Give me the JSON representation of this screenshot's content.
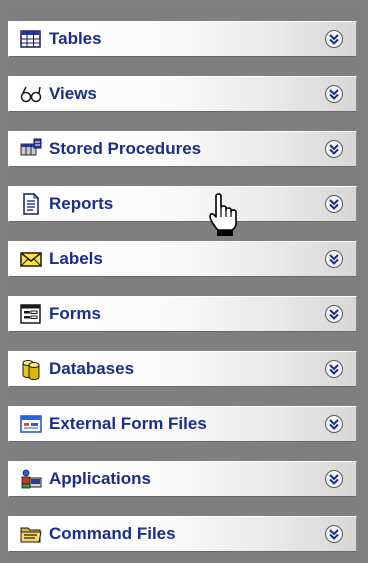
{
  "sections": [
    {
      "label": "Tables",
      "icon": "table-icon"
    },
    {
      "label": "Views",
      "icon": "glasses-icon"
    },
    {
      "label": "Stored Procedures",
      "icon": "stored-procedures-icon"
    },
    {
      "label": "Reports",
      "icon": "report-icon"
    },
    {
      "label": "Labels",
      "icon": "envelope-icon"
    },
    {
      "label": "Forms",
      "icon": "form-icon"
    },
    {
      "label": "Databases",
      "icon": "database-icon"
    },
    {
      "label": "External Form Files",
      "icon": "external-form-icon"
    },
    {
      "label": "Applications",
      "icon": "applications-icon"
    },
    {
      "label": "Command Files",
      "icon": "folder-icon"
    }
  ],
  "expand_icon": "chevron-double-down-icon",
  "cursor_icon": "hand-pointer-icon",
  "colors": {
    "label_text": "#1b2f86",
    "background": "#808080",
    "bar_light": "#ffffff",
    "bar_dark": "#d7d7d7"
  }
}
